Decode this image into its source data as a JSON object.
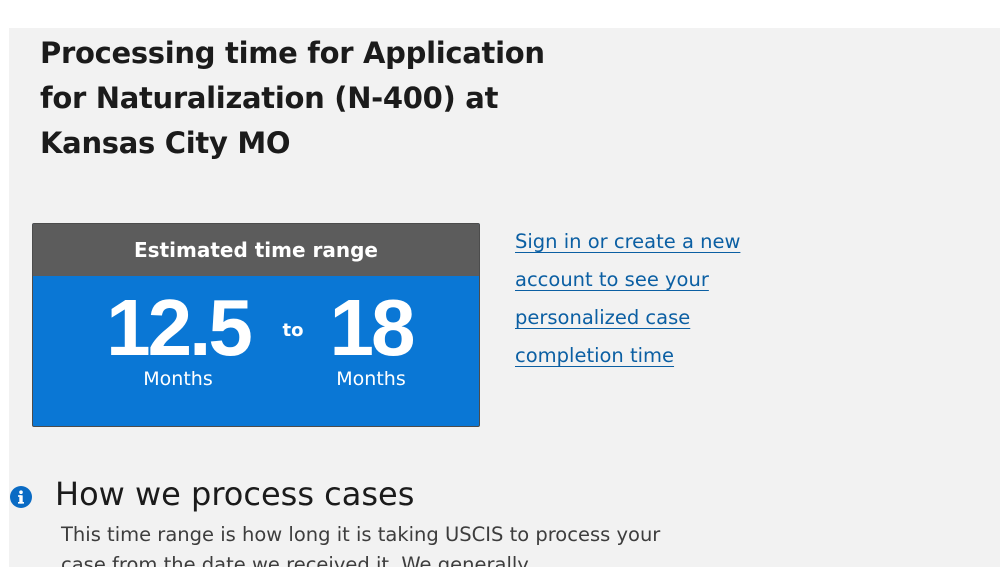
{
  "page": {
    "title": "Processing time for Application for Naturalization (N-400) at Kansas City MO"
  },
  "time_range": {
    "header": "Estimated time range",
    "low_value": "12.5",
    "low_unit": "Months",
    "separator": "to",
    "high_value": "18",
    "high_unit": "Months"
  },
  "signin": {
    "link_text": "Sign in or create a new account to see your personalized case completion time"
  },
  "process_section": {
    "icon": "info-icon",
    "heading": "How we process cases",
    "body": "This time range is how long it is taking USCIS to process your case from the date we received it. We generally"
  },
  "colors": {
    "header_bg": "#5c5c5c",
    "range_bg": "#0a77d5",
    "link": "#0b5fa3",
    "info_icon": "#0a6bc4"
  }
}
